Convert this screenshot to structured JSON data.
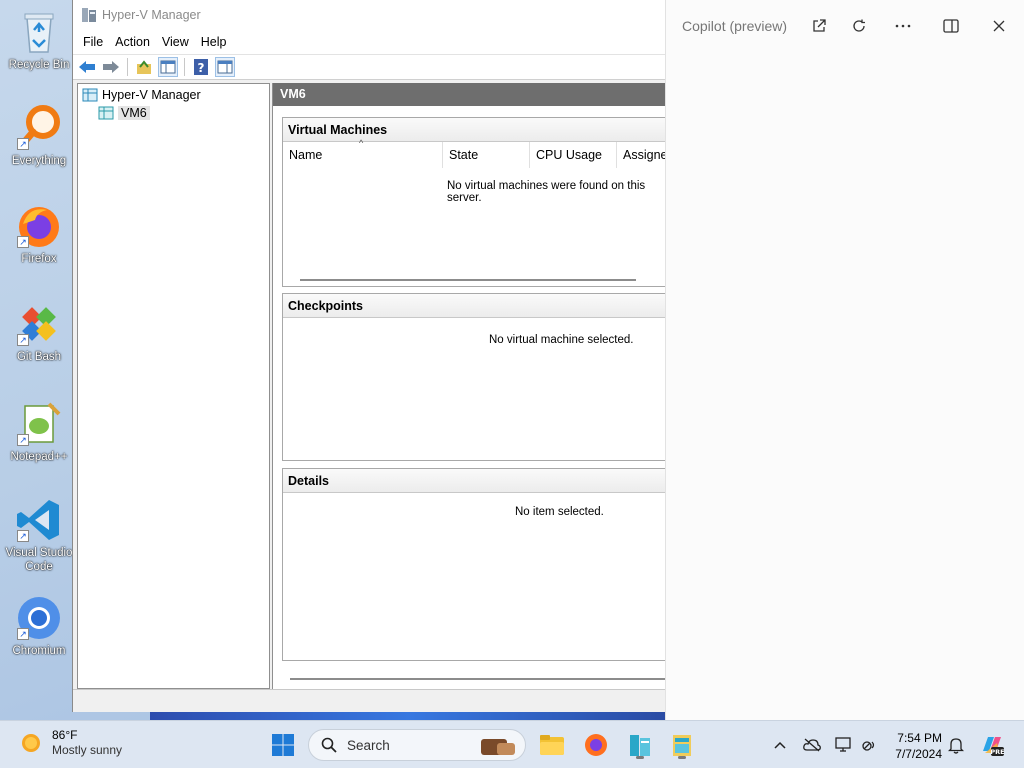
{
  "desktop": {
    "icons": [
      {
        "label": "Recycle Bin",
        "icon": "recycle-bin-icon"
      },
      {
        "label": "Everything",
        "icon": "everything-search-icon"
      },
      {
        "label": "Firefox",
        "icon": "firefox-icon"
      },
      {
        "label": "Git Bash",
        "icon": "git-bash-icon"
      },
      {
        "label": "Notepad++",
        "icon": "notepad-plus-plus-icon"
      },
      {
        "label": "Visual Studio Code",
        "icon": "vscode-icon"
      },
      {
        "label": "Chromium",
        "icon": "chromium-icon"
      }
    ]
  },
  "hyperv": {
    "title": "Hyper-V Manager",
    "menu": [
      "File",
      "Action",
      "View",
      "Help"
    ],
    "tree": {
      "root": "Hyper-V Manager",
      "child": "VM6"
    },
    "header": "VM6",
    "virtual_machines": {
      "title": "Virtual Machines",
      "columns": [
        "Name",
        "State",
        "CPU Usage",
        "Assigne"
      ],
      "empty": "No virtual machines were found on this server."
    },
    "checkpoints": {
      "title": "Checkpoints",
      "empty": "No virtual machine selected."
    },
    "details": {
      "title": "Details",
      "empty": "No item selected."
    }
  },
  "copilot": {
    "title": "Copilot (preview)"
  },
  "taskbar": {
    "weather_temp": "86°F",
    "weather_desc": "Mostly sunny",
    "search_placeholder": "Search",
    "time": "7:54 PM",
    "date": "7/7/2024"
  },
  "colors": {
    "accent": "#0078d4",
    "header_bg": "#6e6e6e",
    "taskbar_bg": "#dde6f2"
  }
}
